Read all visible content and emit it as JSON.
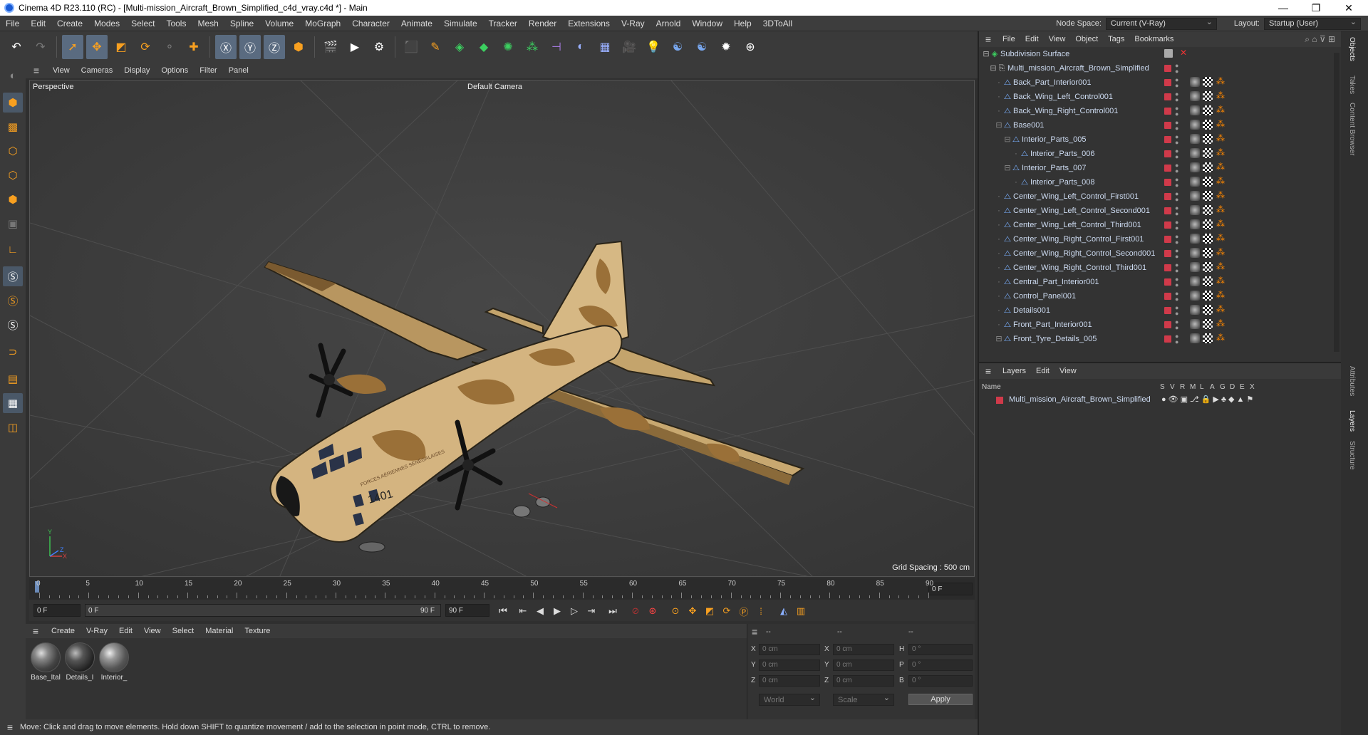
{
  "window": {
    "title": "Cinema 4D R23.110 (RC) - [Multi-mission_Aircraft_Brown_Simplified_c4d_vray.c4d *] - Main",
    "controls": [
      "—",
      "❐",
      "✕"
    ]
  },
  "menubar": {
    "items": [
      "File",
      "Edit",
      "Create",
      "Modes",
      "Select",
      "Tools",
      "Mesh",
      "Spline",
      "Volume",
      "MoGraph",
      "Character",
      "Animate",
      "Simulate",
      "Tracker",
      "Render",
      "Extensions",
      "V-Ray",
      "Arnold",
      "Window",
      "Help",
      "3DToAll"
    ],
    "node_space_label": "Node Space:",
    "node_space_value": "Current (V-Ray)",
    "layout_label": "Layout:",
    "layout_value": "Startup (User)"
  },
  "viewport": {
    "menu": [
      "View",
      "Cameras",
      "Display",
      "Options",
      "Filter",
      "Panel"
    ],
    "label": "Perspective",
    "camera": "Default Camera",
    "grid_spacing": "Grid Spacing : 500 cm",
    "aircraft_number": "1401",
    "aircraft_text": "FORCES AÉRIENNES SÉNÉGALAISES"
  },
  "timeline": {
    "ticks": [
      "0",
      "5",
      "10",
      "15",
      "20",
      "25",
      "30",
      "35",
      "40",
      "45",
      "50",
      "55",
      "60",
      "65",
      "70",
      "75",
      "80",
      "85",
      "90"
    ],
    "end_field": "0 F",
    "start_frame": "0 F",
    "current_frame": "0 F",
    "range_end": "90 F",
    "max_frame": "90 F"
  },
  "materials": {
    "menu": [
      "Create",
      "V-Ray",
      "Edit",
      "View",
      "Select",
      "Material",
      "Texture"
    ],
    "items": [
      "Base_Ital",
      "Details_I",
      "Interior_"
    ]
  },
  "coords": {
    "headers": [
      "--",
      "--",
      "--"
    ],
    "rows": [
      {
        "a": "X",
        "av": "0 cm",
        "b": "X",
        "bv": "0 cm",
        "c": "H",
        "cv": "0 °"
      },
      {
        "a": "Y",
        "av": "0 cm",
        "b": "Y",
        "bv": "0 cm",
        "c": "P",
        "cv": "0 °"
      },
      {
        "a": "Z",
        "av": "0 cm",
        "b": "Z",
        "bv": "0 cm",
        "c": "B",
        "cv": "0 °"
      }
    ],
    "space": "World",
    "mode": "Scale",
    "apply": "Apply"
  },
  "status": "Move: Click and drag to move elements. Hold down SHIFT to quantize movement / add to the selection in point mode, CTRL to remove.",
  "objects": {
    "menu": [
      "File",
      "Edit",
      "View",
      "Object",
      "Tags",
      "Bookmarks"
    ],
    "root": "Subdivision Surface",
    "model": "Multi_mission_Aircraft_Brown_Simplified",
    "items": [
      {
        "name": "Back_Part_Interior001",
        "indent": 0
      },
      {
        "name": "Back_Wing_Left_Control001",
        "indent": 0
      },
      {
        "name": "Back_Wing_Right_Control001",
        "indent": 0
      },
      {
        "name": "Base001",
        "indent": 0
      },
      {
        "name": "Interior_Parts_005",
        "indent": 1
      },
      {
        "name": "Interior_Parts_006",
        "indent": 2
      },
      {
        "name": "Interior_Parts_007",
        "indent": 1
      },
      {
        "name": "Interior_Parts_008",
        "indent": 2
      },
      {
        "name": "Center_Wing_Left_Control_First001",
        "indent": 0
      },
      {
        "name": "Center_Wing_Left_Control_Second001",
        "indent": 0
      },
      {
        "name": "Center_Wing_Left_Control_Third001",
        "indent": 0
      },
      {
        "name": "Center_Wing_Right_Control_First001",
        "indent": 0
      },
      {
        "name": "Center_Wing_Right_Control_Second001",
        "indent": 0
      },
      {
        "name": "Center_Wing_Right_Control_Third001",
        "indent": 0
      },
      {
        "name": "Central_Part_Interior001",
        "indent": 0
      },
      {
        "name": "Control_Panel001",
        "indent": 0
      },
      {
        "name": "Details001",
        "indent": 0
      },
      {
        "name": "Front_Part_Interior001",
        "indent": 0
      },
      {
        "name": "Front_Tyre_Details_005",
        "indent": 0
      }
    ]
  },
  "layers": {
    "menu": [
      "Layers",
      "Edit",
      "View"
    ],
    "head_name": "Name",
    "head_cols": [
      "S",
      "V",
      "R",
      "M",
      "L",
      "A",
      "G",
      "D",
      "E",
      "X"
    ],
    "layer_name": "Multi_mission_Aircraft_Brown_Simplified",
    "layer_color": "#d03a4a"
  },
  "sidetabs": [
    "Objects",
    "Takes",
    "Content Browser",
    "Attributes",
    "Layers",
    "Structure"
  ]
}
